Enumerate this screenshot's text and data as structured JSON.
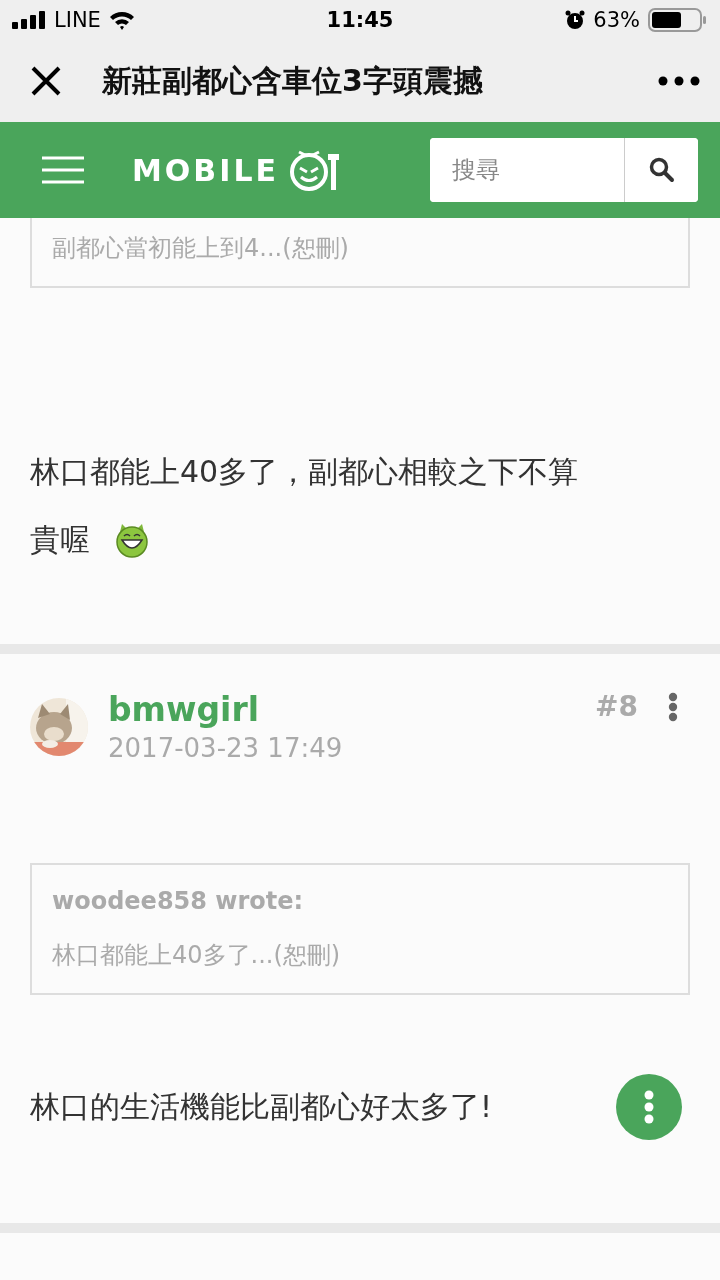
{
  "status_bar": {
    "carrier": "LINE",
    "time": "11:45",
    "battery": "63%"
  },
  "nav_bar": {
    "title": "新莊副都心含車位3字頭震撼"
  },
  "header": {
    "logo": "MOBILE",
    "search": {
      "placeholder": "搜尋"
    }
  },
  "posts": [
    {
      "quote": {
        "text": "副都心當初能上到4...(恕刪)"
      },
      "body": [
        {
          "kind": "text",
          "text": "林口都能上40多了，副都心相較之下不算"
        },
        {
          "kind": "text",
          "text": "貴喔"
        },
        {
          "kind": "emoticon"
        }
      ]
    },
    {
      "author": "bmwgirl",
      "date": "2017-03-23 17:49",
      "number": "#8",
      "quote": {
        "author": "woodee858 wrote:",
        "text": "林口都能上40多了...(恕刪)"
      },
      "body": [
        {
          "kind": "text",
          "text": "林口的生活機能比副都心好太多了!"
        }
      ]
    }
  ]
}
